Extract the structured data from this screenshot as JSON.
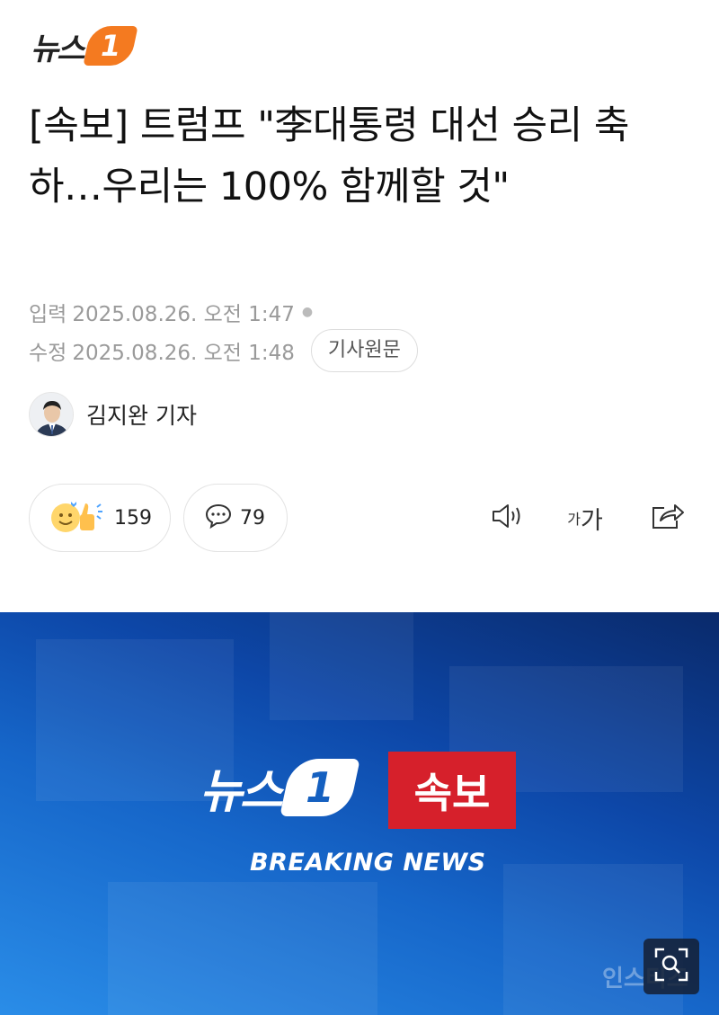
{
  "brand": {
    "logo_text": "뉴스",
    "logo_badge": "1"
  },
  "article": {
    "headline": "[속보] 트럼프 \"李대통령 대선 승리 축하…우리는 100% 함께할 것\"",
    "input_label": "입력",
    "input_time": "2025.08.26. 오전 1:47",
    "edit_label": "수정",
    "edit_time": "2025.08.26. 오전 1:48",
    "original_button": "기사원문",
    "reporter": "김지완 기자"
  },
  "actions": {
    "reaction_count": "159",
    "comment_count": "79",
    "font_small": "가",
    "font_big": "가"
  },
  "hero": {
    "logo_text": "뉴스",
    "logo_badge": "1",
    "breaking_ko": "속보",
    "breaking_en": "BREAKING NEWS",
    "watermark": "인스티즈"
  },
  "colors": {
    "brand_orange": "#f47a20",
    "breaking_red": "#d6202b",
    "hero_blue": "#1666c9"
  }
}
